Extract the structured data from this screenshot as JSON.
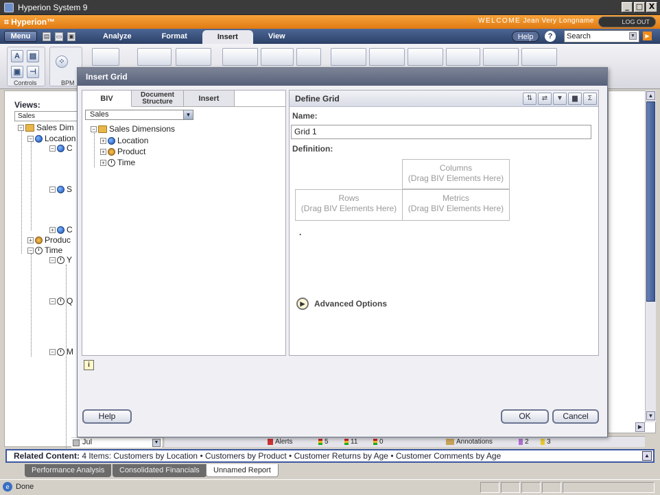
{
  "window": {
    "title": "Hyperion System 9",
    "buttons": {
      "minimize": "_",
      "maximize": "□",
      "close": "X"
    }
  },
  "brand": {
    "logo": "Hyperion",
    "welcome_label": "WELCOME",
    "user": "Jean Very Longname",
    "logout": "LOG OUT"
  },
  "menubar": {
    "menu": "Menu",
    "tabs": [
      "Analyze",
      "Format",
      "Insert",
      "View"
    ],
    "active_tab": "Insert",
    "help": "Help",
    "help_icon": "?",
    "search_placeholder": "Search"
  },
  "ribbon": {
    "controls_label": "Controls",
    "bpm_label": "BPM"
  },
  "left_tree": {
    "views_label": "Views:",
    "views_value": "Sales",
    "nodes": {
      "sales_dim": "Sales Dim",
      "location": "Location",
      "loc_c1": "C",
      "loc_s": "S",
      "loc_c2": "C",
      "product": "Produc",
      "time": "Time",
      "time_y": "Y",
      "time_q": "Q",
      "time_m": "M"
    },
    "jul": "Jul"
  },
  "status_strip": {
    "alerts": "Alerts",
    "alert_red": "5",
    "alert_yellow": "11",
    "alert_green": "0",
    "annotations": "Annotations",
    "annot_a": "2",
    "annot_b": "3"
  },
  "related": {
    "label": "Related Content:",
    "count_text": "4 Items:",
    "items": [
      "Customers by Location",
      "Customers by Product",
      "Customer Returns by Age",
      "Customer Comments by Age"
    ]
  },
  "bottom_tabs": [
    "Performance Analysis",
    "Consolidated Financials",
    "Unnamed Report"
  ],
  "statusbar": {
    "text": "Done"
  },
  "dialog": {
    "title": "Insert Grid",
    "tabs": {
      "biv": "BIV",
      "doc_line1": "Document",
      "doc_line2": "Structure",
      "insert": "Insert"
    },
    "biv_select": "Sales",
    "tree": {
      "root": "Sales Dimensions",
      "children": [
        "Location",
        "Product",
        "Time"
      ]
    },
    "define": {
      "header": "Define Grid",
      "name_label": "Name:",
      "name_value": "Grid 1",
      "definition_label": "Definition:",
      "columns_title": "Columns",
      "columns_hint": "(Drag BIV Elements Here)",
      "rows_title": "Rows",
      "rows_hint": "(Drag BIV Elements Here)",
      "metrics_title": "Metrics",
      "metrics_hint": "(Drag BIV Elements Here)",
      "dot": ".",
      "advanced": "Advanced Options"
    },
    "info_icon": "i",
    "help_button": "Help",
    "ok_button": "OK",
    "cancel_button": "Cancel"
  }
}
